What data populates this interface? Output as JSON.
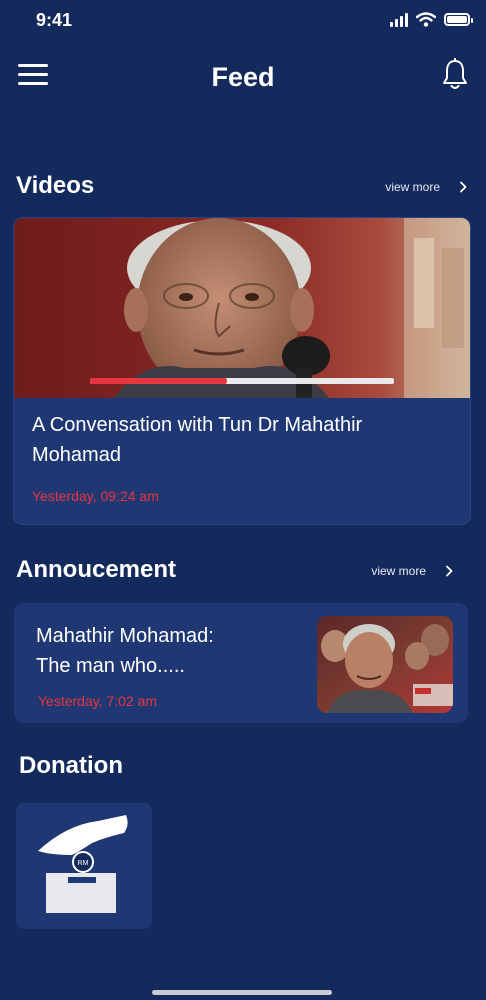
{
  "status_bar": {
    "time": "9:41"
  },
  "header": {
    "title": "Feed",
    "menu_icon": "hamburger-menu-icon",
    "notification_icon": "bell-icon"
  },
  "videos": {
    "section_title": "Videos",
    "view_more": "view more",
    "card": {
      "title": "A Convensation with Tun Dr Mahathir Mohamad",
      "time": "Yesterday, 09:24 am",
      "progress": 0.45
    }
  },
  "announcement": {
    "section_title": "Annoucement",
    "view_more": "view more",
    "card": {
      "title_line1": "Mahathir Mohamad:",
      "title_line2": "The man who.....",
      "time": "Yesterday, 7:02 am"
    }
  },
  "donation": {
    "section_title": "Donation",
    "tile_icon": "donation-box-icon",
    "coin_text": "RM"
  },
  "colors": {
    "background": "#152a5c",
    "card": "#1f3873",
    "accent_red": "#e8363e"
  }
}
